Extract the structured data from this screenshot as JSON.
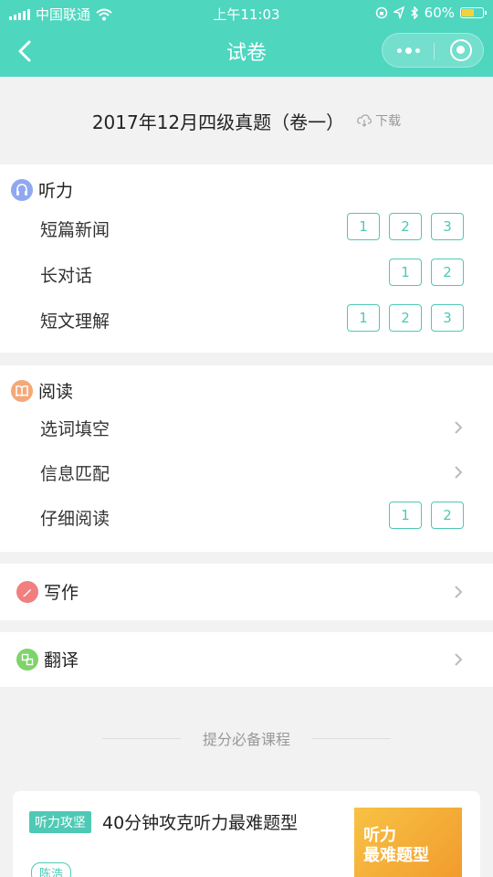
{
  "status_bar": {
    "carrier": "中国联通",
    "time": "上午11:03",
    "battery_percent": "60%",
    "battery_level": 0.6
  },
  "nav": {
    "title": "试卷"
  },
  "exam": {
    "title": "2017年12月四级真题（卷一）",
    "download_label": "下载"
  },
  "sections": {
    "listening": {
      "title": "听力",
      "rows": [
        {
          "label": "短篇新闻",
          "chips": [
            "1",
            "2",
            "3"
          ]
        },
        {
          "label": "长对话",
          "chips": [
            "1",
            "2"
          ]
        },
        {
          "label": "短文理解",
          "chips": [
            "1",
            "2",
            "3"
          ]
        }
      ]
    },
    "reading": {
      "title": "阅读",
      "rows": [
        {
          "label": "选词填空"
        },
        {
          "label": "信息匹配"
        },
        {
          "label": "仔细阅读",
          "chips": [
            "1",
            "2"
          ]
        }
      ]
    },
    "writing": {
      "title": "写作"
    },
    "translation": {
      "title": "翻译"
    }
  },
  "courses": {
    "heading": "提分必备课程",
    "items": [
      {
        "tag": "听力攻坚",
        "title": "40分钟攻克听力最难题型",
        "thumb_text": "听力\n最难题型",
        "teacher": "陈浩"
      }
    ]
  },
  "colors": {
    "accent": "#4ed6bf",
    "chip": "#4ec9b5",
    "listening_icon": "#8fa8ef",
    "reading_icon": "#f4a878",
    "writing_icon": "#f07f7f",
    "translation_icon": "#7fd36a"
  }
}
